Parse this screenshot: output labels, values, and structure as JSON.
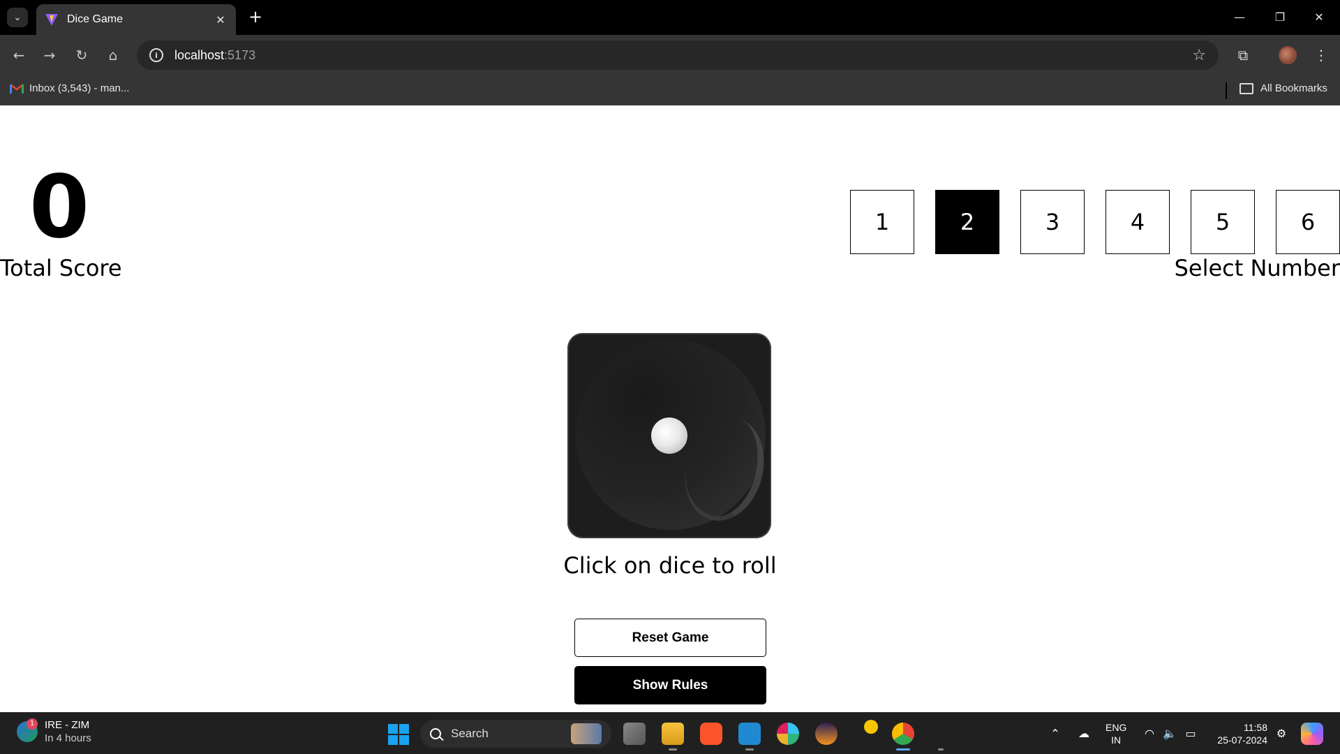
{
  "browser": {
    "tab_title": "Dice Game",
    "tab_close": "✕",
    "new_tab": "+",
    "window_controls": {
      "minimize": "—",
      "restore": "❐",
      "close": "✕"
    },
    "address": {
      "host": "localhost",
      "port": ":5173"
    },
    "bookmarks": {
      "item": "Inbox (3,543) - man...",
      "all": "All Bookmarks"
    }
  },
  "game": {
    "total_score": "0",
    "total_score_label": "Total Score",
    "numbers": [
      "1",
      "2",
      "3",
      "4",
      "5",
      "6"
    ],
    "selected_number": "2",
    "select_label": "Select Number",
    "dice_value": 1,
    "roll_hint": "Click on dice to roll",
    "reset_button": "Reset Game",
    "rules_button": "Show Rules"
  },
  "taskbar": {
    "weather_title": "IRE - ZIM",
    "weather_sub": "In 4 hours",
    "weather_badge": "1",
    "search_label": "Search",
    "lang_top": "ENG",
    "lang_bottom": "IN",
    "time": "11:58",
    "date": "25-07-2024"
  },
  "colors": {
    "chrome_dark": "#000000",
    "chrome_toolbar": "#353535",
    "selected_box": "#000000",
    "taskbar": "#202020"
  }
}
